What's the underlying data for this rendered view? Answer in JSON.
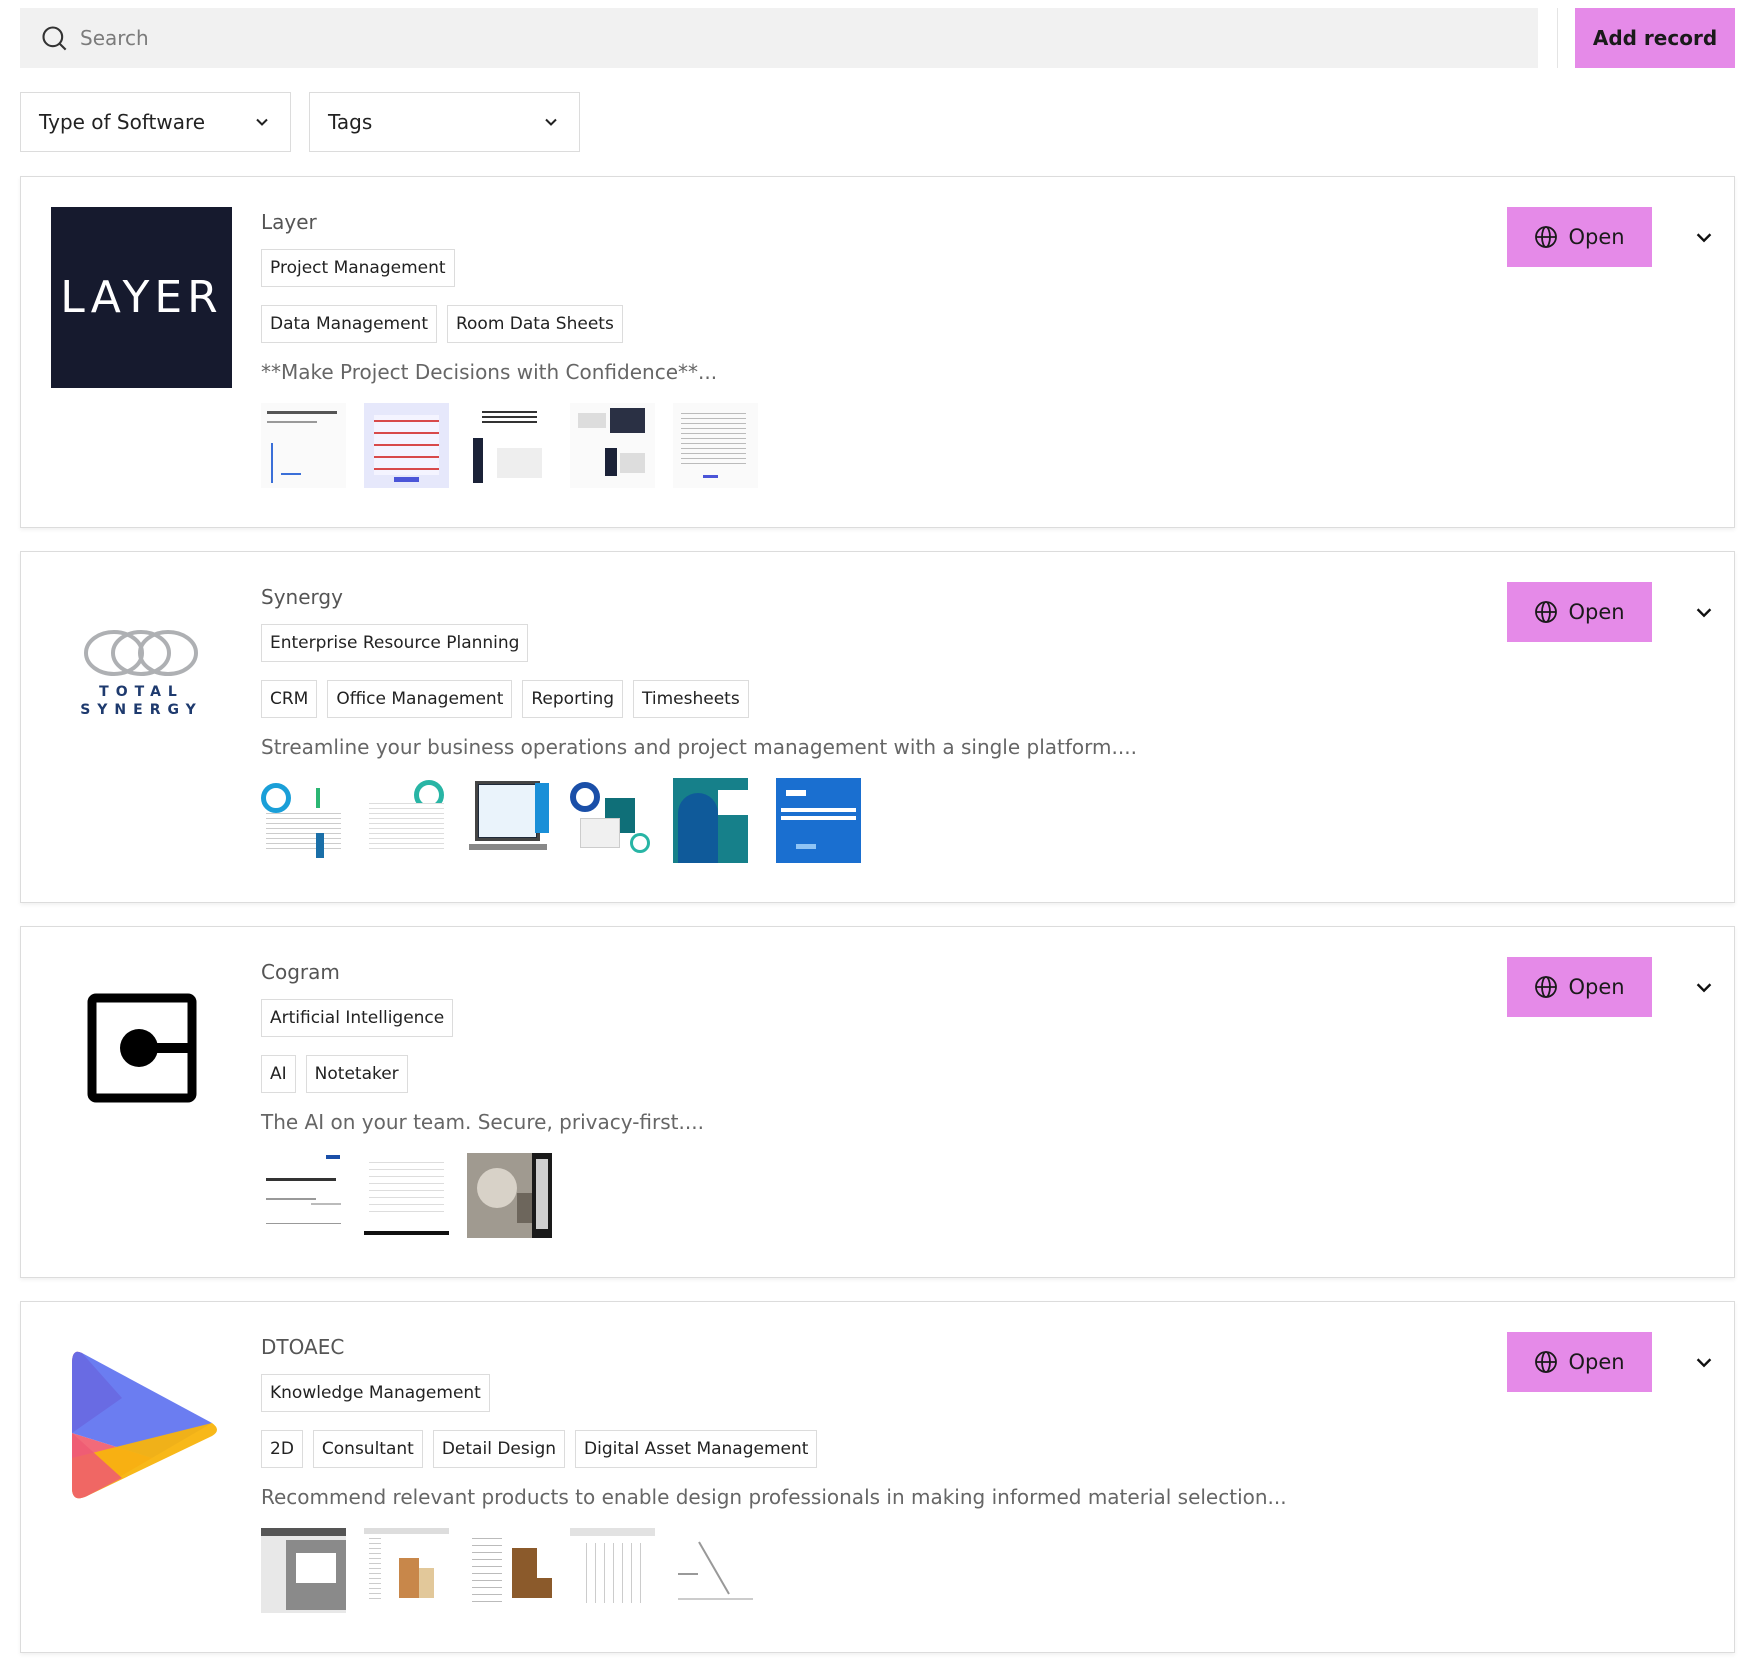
{
  "search": {
    "placeholder": "Search"
  },
  "toolbar": {
    "add_label": "Add record"
  },
  "filters": [
    {
      "label": "Type of Software"
    },
    {
      "label": "Tags"
    }
  ],
  "records": [
    {
      "name": "Layer",
      "primary_tag": "Project Management",
      "tags": [
        "Data Management",
        "Room Data Sheets"
      ],
      "description": "**Make Project Decisions with Confidence**...",
      "logo_text": "LAYER",
      "open_label": "Open",
      "thumbnail_count": 5
    },
    {
      "name": "Synergy",
      "primary_tag": "Enterprise Resource Planning",
      "tags": [
        "CRM",
        "Office Management",
        "Reporting",
        "Timesheets"
      ],
      "description": "Streamline your business operations and project management with a single platform....",
      "logo_text": "TOTAL SYNERGY",
      "open_label": "Open",
      "thumbnail_count": 6
    },
    {
      "name": "Cogram",
      "primary_tag": "Artificial Intelligence",
      "tags": [
        "AI",
        "Notetaker"
      ],
      "description": "The AI on your team. Secure, privacy-first....",
      "open_label": "Open",
      "thumbnail_count": 3
    },
    {
      "name": "DTOAEC",
      "primary_tag": "Knowledge Management",
      "tags": [
        "2D",
        "Consultant",
        "Detail Design",
        "Digital Asset Management"
      ],
      "description": "Recommend relevant products to enable design professionals in making informed material selection...",
      "open_label": "Open",
      "thumbnail_count": 5
    }
  ],
  "colors": {
    "accent": "#e58ae8",
    "layer_logo_bg": "#161a2e"
  }
}
